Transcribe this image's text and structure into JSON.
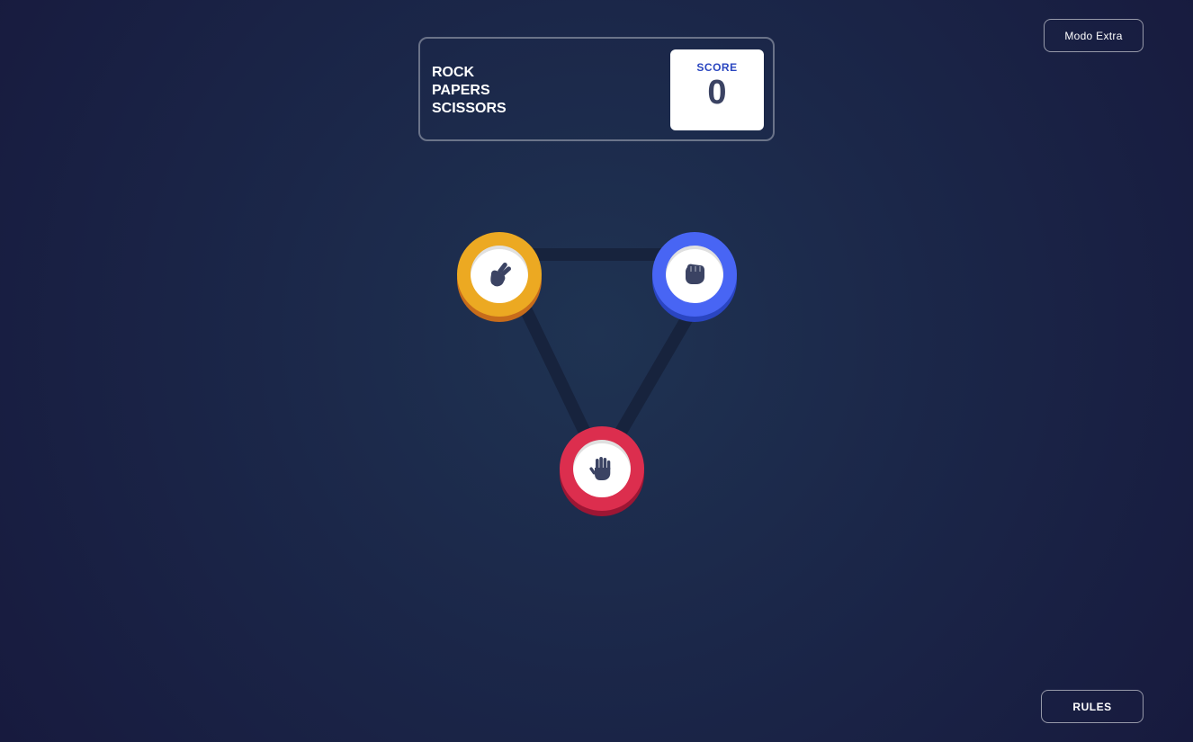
{
  "extra_mode_label": "Modo Extra",
  "header": {
    "title_lines": [
      "ROCK",
      "PAPERS",
      "SCISSORS"
    ],
    "score_label": "SCORE",
    "score_value": "0"
  },
  "tokens": [
    {
      "name": "scissors",
      "color": "#eca922",
      "icon": "scissors-hand-icon"
    },
    {
      "name": "rock",
      "color": "#4865f4",
      "icon": "rock-fist-icon"
    },
    {
      "name": "paper",
      "color": "#dc2e4e",
      "icon": "paper-hand-icon"
    }
  ],
  "rules_label": "RULES",
  "colors": {
    "background": "#1f3352",
    "triangle_line": "#16213a",
    "score_text": "#2a46c0",
    "icon_fill": "#3b4363"
  }
}
